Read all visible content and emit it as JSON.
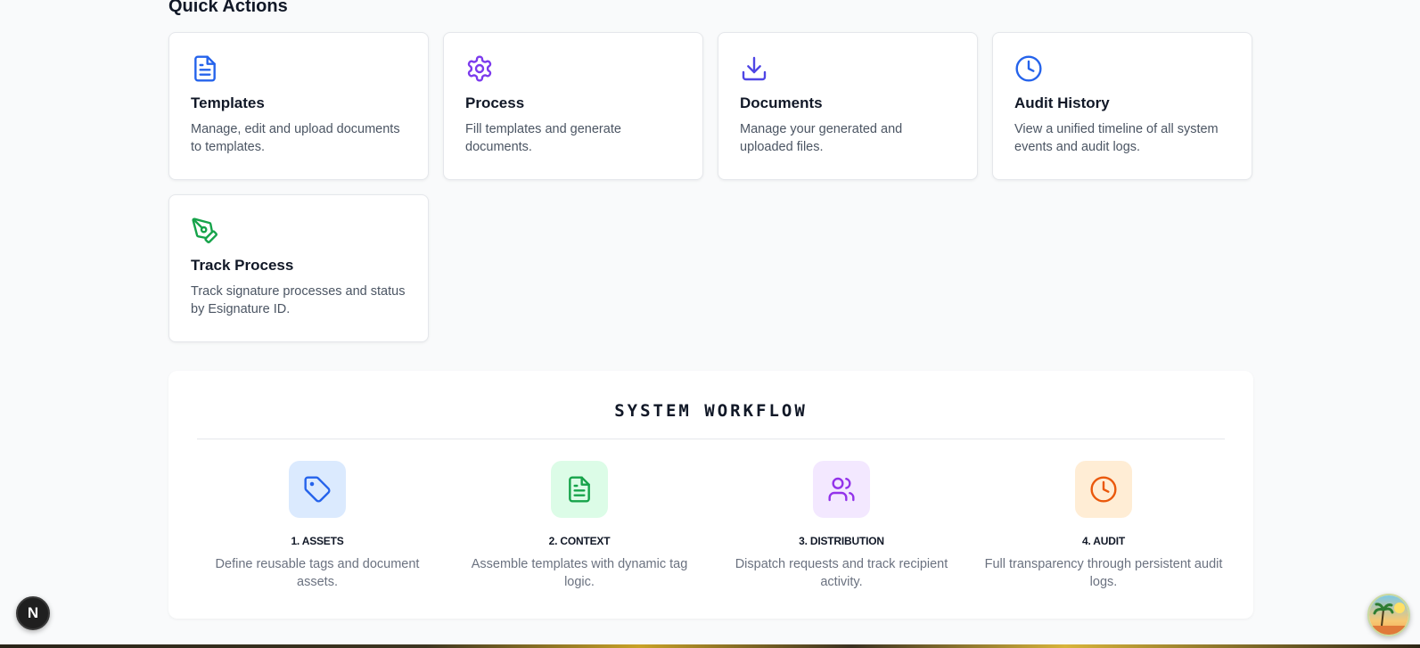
{
  "quick_actions": {
    "heading": "Quick Actions",
    "cards": [
      {
        "title": "Templates",
        "description": "Manage, edit and upload documents to templates.",
        "icon": "file-text-icon",
        "color": "#2563eb"
      },
      {
        "title": "Process",
        "description": "Fill templates and generate documents.",
        "icon": "gear-icon",
        "color": "#7c3aed"
      },
      {
        "title": "Documents",
        "description": "Manage your generated and uploaded files.",
        "icon": "download-icon",
        "color": "#4f46e5"
      },
      {
        "title": "Audit History",
        "description": "View a unified timeline of all system events and audit logs.",
        "icon": "clock-icon",
        "color": "#2563eb"
      },
      {
        "title": "Track Process",
        "description": "Track signature processes and status by Esignature ID.",
        "icon": "pen-tool-icon",
        "color": "#16a34a"
      }
    ]
  },
  "workflow": {
    "title": "SYSTEM WORKFLOW",
    "steps": [
      {
        "label": "1. ASSETS",
        "text": "Define reusable tags and document assets.",
        "icon": "tag-icon",
        "color": "#2563eb",
        "bg": "#dbeafe"
      },
      {
        "label": "2. CONTEXT",
        "text": "Assemble templates with dynamic tag logic.",
        "icon": "file-text-icon",
        "color": "#16a34a",
        "bg": "#dcfce7"
      },
      {
        "label": "3. DISTRIBUTION",
        "text": "Dispatch requests and track recipient activity.",
        "icon": "users-icon",
        "color": "#9333ea",
        "bg": "#f3e8ff"
      },
      {
        "label": "4. AUDIT",
        "text": "Full transparency through persistent audit logs.",
        "icon": "clock-icon",
        "color": "#ea580c",
        "bg": "#ffedd5"
      }
    ]
  },
  "overlay": {
    "next_badge_letter": "N"
  }
}
